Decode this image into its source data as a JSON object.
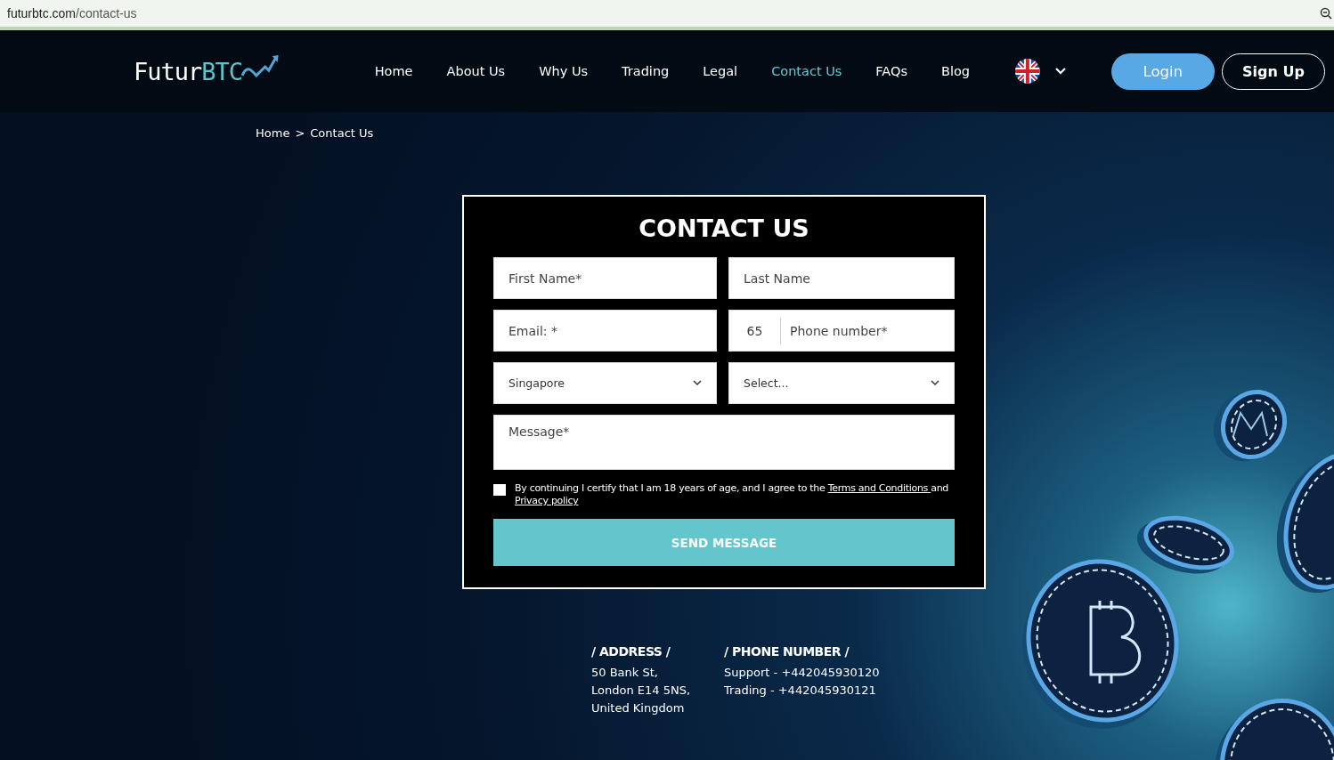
{
  "browser": {
    "url_host": "futurbtc.com",
    "url_path": "/contact-us"
  },
  "header": {
    "logo_primary": "Futur",
    "logo_accent": "BTC",
    "nav": [
      {
        "label": "Home",
        "selected": false
      },
      {
        "label": "About Us",
        "selected": false
      },
      {
        "label": "Why Us",
        "selected": false
      },
      {
        "label": "Trading",
        "selected": false
      },
      {
        "label": "Legal",
        "selected": false
      },
      {
        "label": "Contact Us",
        "selected": true
      },
      {
        "label": "FAQs",
        "selected": false
      },
      {
        "label": "Blog",
        "selected": false
      }
    ],
    "login": "Login",
    "signup": "Sign Up"
  },
  "breadcrumb": {
    "items": [
      "Home",
      "Contact Us"
    ],
    "separator": ">"
  },
  "form": {
    "title": "CONTACT US",
    "fields": [
      {
        "kind": "text",
        "placeholder": "First Name*"
      },
      {
        "kind": "text",
        "placeholder": "Last Name"
      },
      {
        "kind": "text",
        "placeholder": "Email: *"
      },
      {
        "kind": "phone",
        "code": "65",
        "placeholder": "Phone number*"
      },
      {
        "kind": "select",
        "value": "Singapore"
      },
      {
        "kind": "select",
        "value": "Select..."
      },
      {
        "kind": "textarea",
        "placeholder": "Message*"
      }
    ],
    "consent": {
      "checked": false,
      "text": "By continuing I certify that I am 18 years of age, and I agree to the ",
      "terms_link": "Terms and Conditions ",
      "and_text": "and",
      "privacy_link": "Privacy policy"
    },
    "submit": "SEND MESSAGE"
  },
  "contacts": [
    {
      "heading": "/ ADDRESS /",
      "lines": [
        "50 Bank St,",
        "London E14 5NS,",
        "United Kingdom"
      ]
    },
    {
      "heading": "/ PHONE NUMBER /",
      "lines": [
        "Support - +442045930120",
        "Trading - +442045930121"
      ]
    }
  ]
}
